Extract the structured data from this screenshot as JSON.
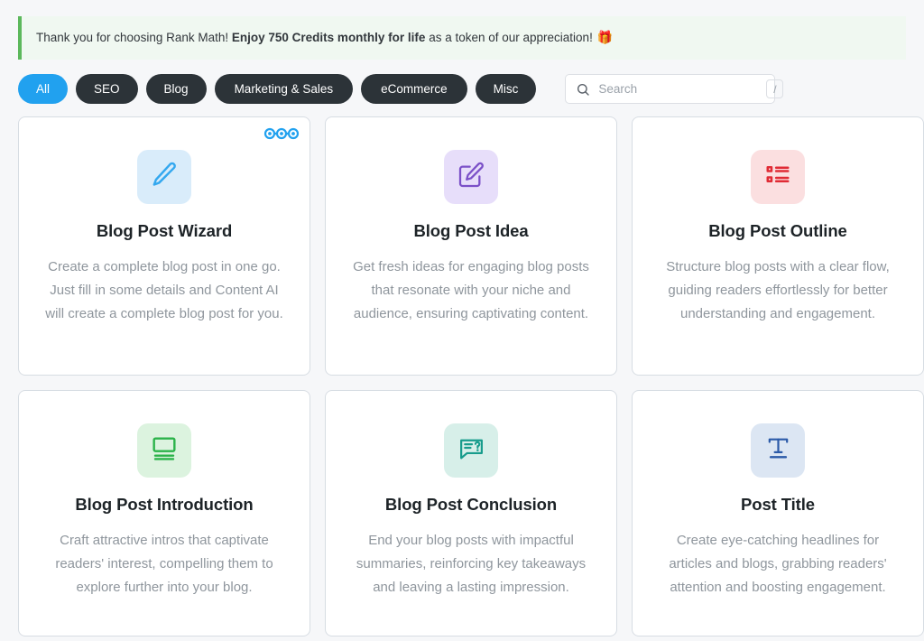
{
  "notice": {
    "text_before": "Thank you for choosing Rank Math!",
    "text_bold": "Enjoy 750 Credits monthly for life",
    "text_after": "as a token of our appreciation!",
    "emoji": "🎁",
    "accent_color": "#5cb85c",
    "background_color": "#f0f8f1"
  },
  "filters": {
    "items": [
      {
        "label": "All",
        "active": true
      },
      {
        "label": "SEO",
        "active": false
      },
      {
        "label": "Blog",
        "active": false
      },
      {
        "label": "Marketing & Sales",
        "active": false
      },
      {
        "label": "eCommerce",
        "active": false
      },
      {
        "label": "Misc",
        "active": false
      }
    ],
    "active_color": "#21a1ef",
    "inactive_color": "#2c3338"
  },
  "search": {
    "placeholder": "Search",
    "value": "",
    "shortcut_key": "/",
    "icon": "search-icon"
  },
  "cards": [
    {
      "title": "Blog Post Wizard",
      "description": "Create a complete blog post in one go. Just fill in some details and Content AI will create a complete blog post for you.",
      "icon": "pencil-icon",
      "icon_color": "#34a8ef",
      "icon_background": "#d9ecfa",
      "badge": "workflow-steps-badge",
      "badge_color": "#21a1ef"
    },
    {
      "title": "Blog Post Idea",
      "description": "Get fresh ideas for engaging blog posts that resonate with your niche and audience, ensuring captivating content.",
      "icon": "edit-square-icon",
      "icon_color": "#7b50c8",
      "icon_background": "#e7defa",
      "badge": null,
      "badge_color": null
    },
    {
      "title": "Blog Post Outline",
      "description": "Structure blog posts with a clear flow, guiding readers effortlessly for better understanding and engagement.",
      "icon": "list-outline-icon",
      "icon_color": "#e02b35",
      "icon_background": "#fbdfe0",
      "badge": null,
      "badge_color": null
    },
    {
      "title": "Blog Post Introduction",
      "description": "Craft attractive intros that captivate readers' interest, compelling them to explore further into your blog.",
      "icon": "monitor-text-icon",
      "icon_color": "#2bb34a",
      "icon_background": "#dcf3df",
      "badge": null,
      "badge_color": null
    },
    {
      "title": "Blog Post Conclusion",
      "description": "End your blog posts with impactful summaries, reinforcing key takeaways and leaving a lasting impression.",
      "icon": "question-bubble-icon",
      "icon_color": "#179c8c",
      "icon_background": "#d7efe9",
      "badge": null,
      "badge_color": null
    },
    {
      "title": "Post Title",
      "description": "Create eye-catching headlines for articles and blogs, grabbing readers' attention and boosting engagement.",
      "icon": "title-format-icon",
      "icon_color": "#2b5aa8",
      "icon_background": "#dce6f3",
      "badge": null,
      "badge_color": null
    }
  ]
}
